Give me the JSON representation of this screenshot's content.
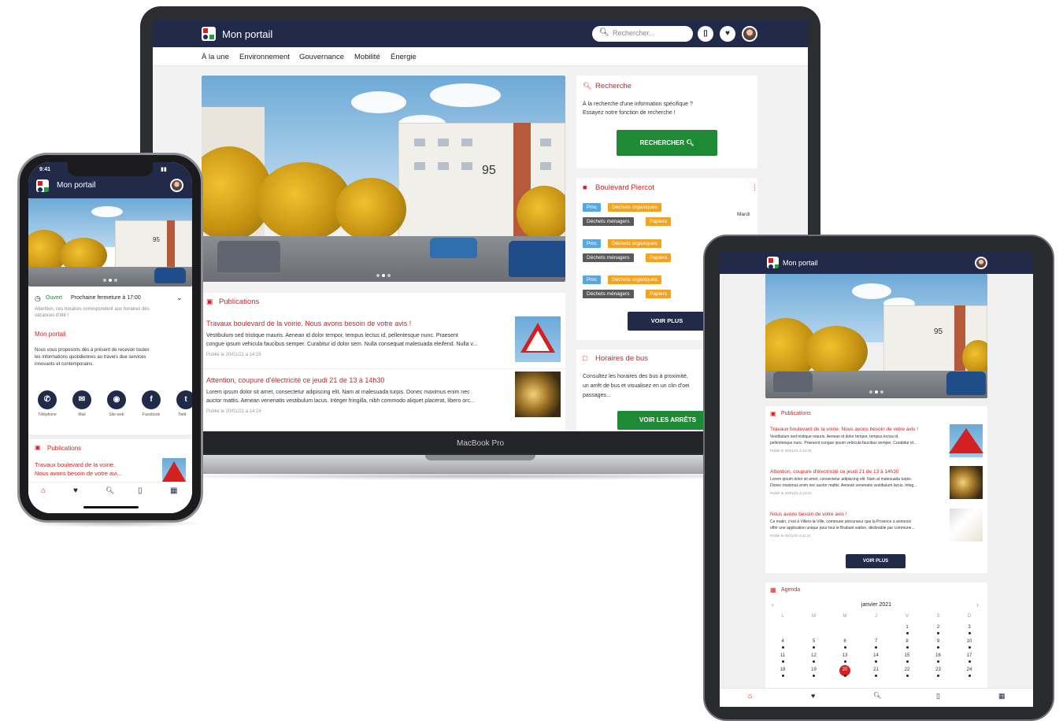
{
  "app": {
    "title": "Mon portail"
  },
  "laptop": {
    "search_placeholder": "Rechercher...",
    "nav": [
      "À la une",
      "Environnement",
      "Gouvernance",
      "Mobilité",
      "Énergie"
    ],
    "hero_number": "95",
    "recherche": {
      "title": "Recherche",
      "text_line1": "À la recherche d'une information spécifique ?",
      "text_line2": "Essayez notre fonction de recherche !",
      "button": "RECHERCHER"
    },
    "waste": {
      "title": "Boulevard Piercot",
      "day": "Mardi",
      "rows": [
        [
          "Pmc",
          "Déchets organiques"
        ],
        [
          "Déchets ménagers",
          "Papiers"
        ],
        [
          "Pmc",
          "Déchets organiques"
        ],
        [
          "Déchets ménagers",
          "Papiers"
        ],
        [
          "Pmc",
          "Déchets organiques"
        ],
        [
          "Déchets ménagers",
          "Papiers"
        ]
      ],
      "button": "VOIR PLUS"
    },
    "bus": {
      "title": "Horaires de bus",
      "text_line1": "Consultez les horaires des bus à proximité,",
      "text_line2": "un arrêt de bus et visualisez en un clin d'oei",
      "text_line3": "passages...",
      "button": "VOIR LES ARRÊTS"
    },
    "publications": {
      "title": "Publications",
      "items": [
        {
          "title": "Travaux boulevard de la voirie. Nous avons besoin de votre avis !",
          "line1": "Vestibulum sed tristique mauris. Aenean id dolor tempor, tempus lectus id, pellentesque nunc. Praesent",
          "line2": "congue ipsum vehicula faucibus semper. Curabitur id dolor sem. Nulla consequat malesuada eleifend. Nulla v...",
          "date": "Publié le 20/01/21 à 14:26"
        },
        {
          "title": "Attention, coupure d'électricité ce jeudi 21 de 13 à 14h30",
          "line1": "Lorem ipsum dolor sit amet, consectetur adipiscing elit. Nam at malesuada turpis. Donec maximus enim nec",
          "line2": "auctor mattis. Aenean venenatis vestibulum lacus. Integer fringilla, nibh commodo aliquet placerat, libero orc...",
          "date": "Publié le 20/01/21 à 14:24"
        }
      ]
    },
    "macbook_label": "MacBook Pro"
  },
  "phone": {
    "time": "9:41",
    "status_open": "Ouvert",
    "status_next": "Prochaine fermeture à 17:00",
    "status_note_line1": "Attention, ces horaires correspondent aux horaires des",
    "status_note_line2": "vacances d'été !",
    "about_title": "Mon portail",
    "about_line1": "Nous vous proposons dès à présent de recevoir toutes",
    "about_line2": "les informations quotidiennes au travers due services",
    "about_line3": "innovants et contemporains.",
    "contacts": [
      "Téléphone",
      "Mail",
      "Site web",
      "Facebook",
      "Twitt"
    ],
    "pub_title": "Publications",
    "pub_item_line1": "Travaux boulevard de la voirie.",
    "pub_item_line2": "Nous avons besoin de votre avi..."
  },
  "tablet": {
    "pub_title": "Publications",
    "items": [
      {
        "title": "Travaux boulevard de la voirie. Nous avons besoin de votre avis !",
        "line1": "Vestibulum sed tristique mauris. Aenean id dolor tempor, tempus lectus id,",
        "line2": "pellentesque nunc. Praesent congue ipsum vehicula faucibus semper. Curabitur id...",
        "date": "Publié le 20/01/21 à 14:26"
      },
      {
        "title": "Attention, coupure d'électricité ce jeudi 21 de 13 à 14h30",
        "line1": "Lorem ipsum dolor sit amet, consectetur adipiscing elit. Nam at malesuada turpis.",
        "line2": "Donec maximus enim nec auctor mattis. Aenean venenatis vestibulum lacus. Integ...",
        "date": "Publié le 20/01/21 à 14:24"
      },
      {
        "title": "Nous avons besoin de votre avis !",
        "line1": "Ce matin, c'est à Villers-la-Ville, commune précurseur que la Province a annoncé",
        "line2": "offrir une application unique pour tout le Brabant wallon, déclinable par commune...",
        "date": "Publié le 05/11/20 à 11:24"
      }
    ],
    "button": "VOIR PLUS",
    "agenda_title": "Agenda",
    "month": "janvier 2021",
    "weekdays": [
      "L",
      "M",
      "M",
      "J",
      "V",
      "S",
      "D"
    ],
    "weeks": [
      [
        "",
        "",
        "",
        "",
        "1",
        "2",
        "3"
      ],
      [
        "4",
        "5",
        "6",
        "7",
        "8",
        "9",
        "10"
      ],
      [
        "11",
        "12",
        "13",
        "14",
        "15",
        "16",
        "17"
      ],
      [
        "18",
        "19",
        "20",
        "21",
        "22",
        "23",
        "24"
      ]
    ],
    "selected_day": "20"
  },
  "icons": {
    "search": "search-icon",
    "map": "map-icon",
    "heart": "heart-icon",
    "home": "home-icon",
    "grid": "grid-icon",
    "trash": "trash-icon",
    "bus": "bus-icon"
  },
  "colors": {
    "navy": "#222a4a",
    "red": "#d32121",
    "green": "#1f8a36",
    "blue_tag": "#5aa7dd",
    "orange_tag": "#f1a321"
  }
}
